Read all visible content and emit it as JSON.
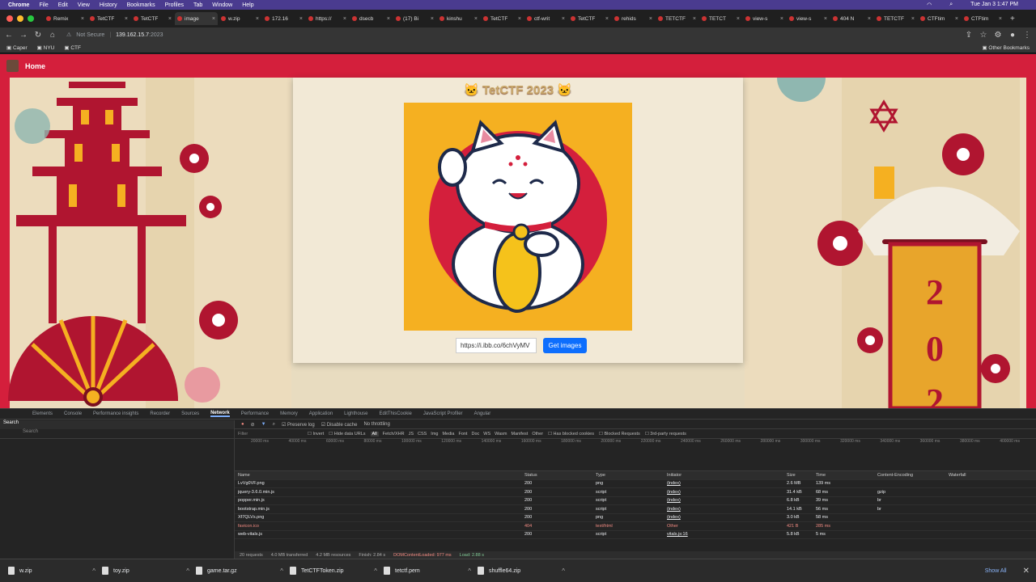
{
  "menubar": {
    "app": "Chrome",
    "items": [
      "File",
      "Edit",
      "View",
      "History",
      "Bookmarks",
      "Profiles",
      "Tab",
      "Window",
      "Help"
    ],
    "clock": "Tue Jan 3  1:47 PM"
  },
  "tabs": [
    {
      "label": "Remix"
    },
    {
      "label": "TetCTF"
    },
    {
      "label": "TetCTF"
    },
    {
      "label": "image"
    },
    {
      "label": "w.zip"
    },
    {
      "label": "172.16"
    },
    {
      "label": "https://"
    },
    {
      "label": "dsecb"
    },
    {
      "label": "(17) Bi"
    },
    {
      "label": "kinshu"
    },
    {
      "label": "TetCTF"
    },
    {
      "label": "ctf-writ"
    },
    {
      "label": "TetCTF"
    },
    {
      "label": "rehids"
    },
    {
      "label": "TETCTF"
    },
    {
      "label": "TETCT"
    },
    {
      "label": "view-s"
    },
    {
      "label": "view-s"
    },
    {
      "label": "404 N"
    },
    {
      "label": "TETCTF"
    },
    {
      "label": "CTFtim"
    },
    {
      "label": "CTFtim"
    }
  ],
  "address": {
    "security": "Not Secure",
    "host": "139.162.15.7",
    "port": ":2023"
  },
  "bookmarks": {
    "items": [
      "Caper",
      "NYU",
      "CTF"
    ],
    "other": "Other Bookmarks"
  },
  "site": {
    "nav_home": "Home",
    "title": "TetCTF 2023",
    "input_value": "https://i.ibb.co/6chVyMV",
    "button_label": "Get images"
  },
  "devtools": {
    "tabs": [
      "Elements",
      "Console",
      "Performance insights",
      "Recorder",
      "Sources",
      "Network",
      "Performance",
      "Memory",
      "Application",
      "Lighthouse",
      "EditThisCookie",
      "JavaScript Profiler",
      "Angular"
    ],
    "active_tab": "Network",
    "search_title": "Search",
    "search_placeholder": "Search",
    "toolbar": {
      "preserve_log": "Preserve log",
      "disable_cache": "Disable cache",
      "throttling": "No throttling"
    },
    "filter": {
      "placeholder": "Filter",
      "invert": "Invert",
      "hide_data_urls": "Hide data URLs",
      "types": [
        "All",
        "Fetch/XHR",
        "JS",
        "CSS",
        "Img",
        "Media",
        "Font",
        "Doc",
        "WS",
        "Wasm",
        "Manifest",
        "Other"
      ],
      "blocked_cookies": "Has blocked cookies",
      "blocked_requests": "Blocked Requests",
      "third_party": "3rd-party requests"
    },
    "timeline_ticks": [
      "20000 ms",
      "40000 ms",
      "60000 ms",
      "80000 ms",
      "100000 ms",
      "120000 ms",
      "140000 ms",
      "160000 ms",
      "180000 ms",
      "200000 ms",
      "220000 ms",
      "240000 ms",
      "260000 ms",
      "280000 ms",
      "300000 ms",
      "320000 ms",
      "340000 ms",
      "360000 ms",
      "380000 ms",
      "400000 ms"
    ],
    "columns": [
      "Name",
      "Status",
      "Type",
      "Initiator",
      "Size",
      "Time",
      "Content-Encoding",
      "Waterfall"
    ],
    "rows": [
      {
        "name": "LvVg0VF.png",
        "status": "200",
        "type": "png",
        "initiator": "(index)",
        "size": "2.6 MB",
        "time": "139 ms",
        "encoding": ""
      },
      {
        "name": "jquery-3.6.0.min.js",
        "status": "200",
        "type": "script",
        "initiator": "(index)",
        "size": "31.4 kB",
        "time": "68 ms",
        "encoding": "gzip"
      },
      {
        "name": "popper.min.js",
        "status": "200",
        "type": "script",
        "initiator": "(index)",
        "size": "6.8 kB",
        "time": "39 ms",
        "encoding": "br"
      },
      {
        "name": "bootstrap.min.js",
        "status": "200",
        "type": "script",
        "initiator": "(index)",
        "size": "14.1 kB",
        "time": "56 ms",
        "encoding": "br"
      },
      {
        "name": "Xf7QLVs.png",
        "status": "200",
        "type": "png",
        "initiator": "(index)",
        "size": "3.0 kB",
        "time": "58 ms",
        "encoding": ""
      },
      {
        "name": "favicon.ico",
        "status": "404",
        "type": "text/html",
        "initiator": "Other",
        "size": "421 B",
        "time": "285 ms",
        "encoding": ""
      },
      {
        "name": "web-vitals.js",
        "status": "200",
        "type": "script",
        "initiator": "vitals.js:16",
        "size": "5.8 kB",
        "time": "5 ms",
        "encoding": ""
      }
    ],
    "status_line": {
      "requests": "20 requests",
      "transferred": "4.0 MB transferred",
      "resources": "4.2 MB resources",
      "finish": "Finish: 2.84 s",
      "dom": "DOMContentLoaded: 977 ms",
      "load": "Load: 2.88 s"
    }
  },
  "downloads": {
    "items": [
      "w.zip",
      "toy.zip",
      "game.tar.gz",
      "TetCTFToken.zip",
      "tetctf.pem",
      "shuffle64.zip"
    ],
    "show_all": "Show All"
  },
  "colors": {
    "brand_red": "#d41f3c",
    "cat_bg": "#f5b021",
    "button_blue": "#0d6efd",
    "menubar": "#4a3b8f"
  }
}
